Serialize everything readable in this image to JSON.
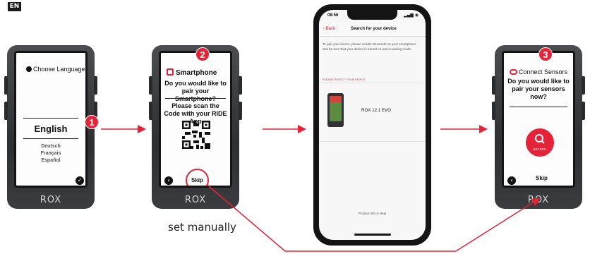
{
  "language_tag": "EN",
  "device_brand": "ROX",
  "step1": {
    "badge": "1",
    "title": "Choose Language",
    "selected": "English",
    "options": [
      "Deutsch",
      "Français",
      "Español"
    ],
    "confirm_icon": "checkmark-icon"
  },
  "step2": {
    "badge": "2",
    "title": "Smartphone",
    "question": "Do you would like to pair your Smartphone?",
    "scan_text": "Please scan the Code with your RIDE App",
    "skip_label": "Skip",
    "back_icon": "back-arrow-icon"
  },
  "phone": {
    "time": "08:56",
    "back_label": "Back",
    "title": "Search for your device",
    "info": "To pair your device, please enable Bluetooth on your smartphone and be sure that your device is turned on and in pairing mode.",
    "section": "PLEASE SELECT YOUR DEVICE",
    "device_name": "ROX 12.1 EVO",
    "footer": "Product info & Help"
  },
  "step3": {
    "badge": "3",
    "title": "Connect Sensors",
    "question": "Do you would like to pair your sensors now?",
    "search_label": "SEARCH",
    "skip_label": "Skip"
  },
  "caption": "set manually",
  "accent_color": "#e52338"
}
